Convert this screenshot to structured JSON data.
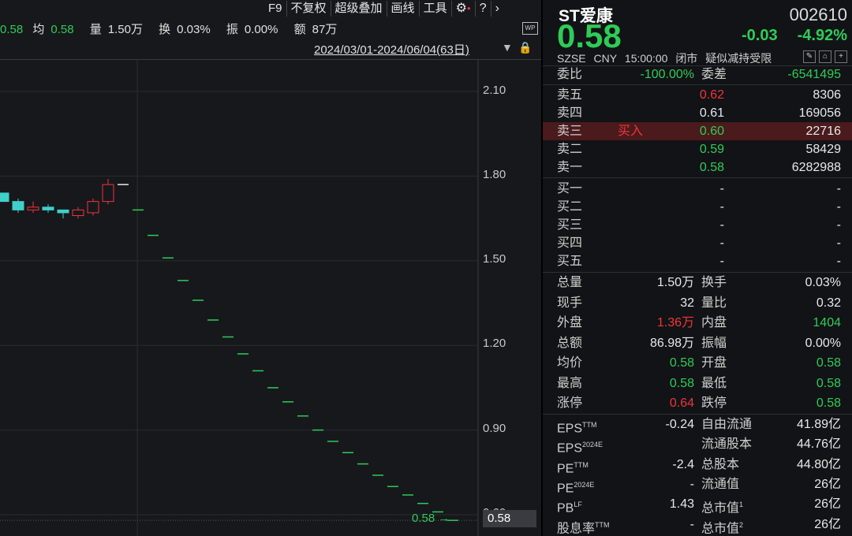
{
  "toolbar": {
    "items": [
      "F9",
      "不复权",
      "超级叠加",
      "画线",
      "工具"
    ],
    "settings_icon": "gear-icon",
    "help_icon": "help-icon",
    "next_icon": "chevron-right-icon"
  },
  "stats": {
    "last": "0.58",
    "avg_label": "均",
    "avg": "0.58",
    "vol_label": "量",
    "vol": "1.50万",
    "turnover_label": "换",
    "turnover": "0.03%",
    "amp_label": "振",
    "amp": "0.00%",
    "amount_label": "额",
    "amount": "87万"
  },
  "range": "2024/03/01-2024/06/04(63日)",
  "y_ticks": [
    "2.10",
    "1.80",
    "1.50",
    "1.20",
    "0.90",
    "0.60"
  ],
  "last_price_label": "0.58",
  "last_price_box": "0.58",
  "colors": {
    "up": "#f0353a",
    "down": "#2ecc57",
    "flat": "#e8e8e8",
    "candle_down": "#3fd1c9"
  },
  "chart_data": {
    "type": "candlestick",
    "ylim": [
      0.55,
      2.2
    ],
    "y_ticks": [
      2.1,
      1.8,
      1.5,
      1.2,
      0.9,
      0.6
    ],
    "candles": [
      {
        "o": 1.74,
        "c": 1.71,
        "h": 1.74,
        "l": 1.71
      },
      {
        "o": 1.71,
        "c": 1.68,
        "h": 1.72,
        "l": 1.67
      },
      {
        "o": 1.68,
        "c": 1.69,
        "h": 1.71,
        "l": 1.67
      },
      {
        "o": 1.69,
        "c": 1.68,
        "h": 1.7,
        "l": 1.67
      },
      {
        "o": 1.68,
        "c": 1.67,
        "h": 1.68,
        "l": 1.65
      },
      {
        "o": 1.66,
        "c": 1.68,
        "h": 1.69,
        "l": 1.65
      },
      {
        "o": 1.67,
        "c": 1.71,
        "h": 1.72,
        "l": 1.66
      },
      {
        "o": 1.71,
        "c": 1.77,
        "h": 1.79,
        "l": 1.7
      },
      {
        "o": 1.77,
        "c": 1.77,
        "h": 1.77,
        "l": 1.77
      },
      {
        "o": 1.68,
        "c": 1.68,
        "h": 1.68,
        "l": 1.68
      },
      {
        "o": 1.59,
        "c": 1.59,
        "h": 1.59,
        "l": 1.59
      },
      {
        "o": 1.51,
        "c": 1.51,
        "h": 1.51,
        "l": 1.51
      },
      {
        "o": 1.43,
        "c": 1.43,
        "h": 1.43,
        "l": 1.43
      },
      {
        "o": 1.36,
        "c": 1.36,
        "h": 1.36,
        "l": 1.36
      },
      {
        "o": 1.29,
        "c": 1.29,
        "h": 1.29,
        "l": 1.29
      },
      {
        "o": 1.23,
        "c": 1.23,
        "h": 1.23,
        "l": 1.23
      },
      {
        "o": 1.17,
        "c": 1.17,
        "h": 1.17,
        "l": 1.17
      },
      {
        "o": 1.11,
        "c": 1.11,
        "h": 1.11,
        "l": 1.11
      },
      {
        "o": 1.05,
        "c": 1.05,
        "h": 1.05,
        "l": 1.05
      },
      {
        "o": 1.0,
        "c": 1.0,
        "h": 1.0,
        "l": 1.0
      },
      {
        "o": 0.95,
        "c": 0.95,
        "h": 0.95,
        "l": 0.95
      },
      {
        "o": 0.9,
        "c": 0.9,
        "h": 0.9,
        "l": 0.9
      },
      {
        "o": 0.86,
        "c": 0.86,
        "h": 0.86,
        "l": 0.86
      },
      {
        "o": 0.82,
        "c": 0.82,
        "h": 0.82,
        "l": 0.82
      },
      {
        "o": 0.78,
        "c": 0.78,
        "h": 0.78,
        "l": 0.78
      },
      {
        "o": 0.74,
        "c": 0.74,
        "h": 0.74,
        "l": 0.74
      },
      {
        "o": 0.7,
        "c": 0.7,
        "h": 0.7,
        "l": 0.7
      },
      {
        "o": 0.67,
        "c": 0.67,
        "h": 0.67,
        "l": 0.67
      },
      {
        "o": 0.64,
        "c": 0.64,
        "h": 0.64,
        "l": 0.64
      },
      {
        "o": 0.61,
        "c": 0.61,
        "h": 0.61,
        "l": 0.61
      },
      {
        "o": 0.58,
        "c": 0.58,
        "h": 0.58,
        "l": 0.58
      }
    ]
  },
  "quote": {
    "name": "ST爱康",
    "code": "002610",
    "price": "0.58",
    "change": "-0.03",
    "change_pct": "-4.92%",
    "exchange": "SZSE",
    "currency": "CNY",
    "time": "15:00:00",
    "status": "闭市",
    "note": "疑似减持受限",
    "icons": [
      "edit-icon",
      "alert-icon",
      "add-icon"
    ],
    "ratio": {
      "label1": "委比",
      "val1": "-100.00%",
      "label2": "委差",
      "val2": "-6541495"
    },
    "asks": [
      {
        "label": "卖五",
        "tag": "",
        "price": "0.62",
        "vol": "8306",
        "color": "red"
      },
      {
        "label": "卖四",
        "tag": "",
        "price": "0.61",
        "vol": "169056",
        "color": "white"
      },
      {
        "label": "卖三",
        "tag": "买入",
        "price": "0.60",
        "vol": "22716",
        "color": "green"
      },
      {
        "label": "卖二",
        "tag": "",
        "price": "0.59",
        "vol": "58429",
        "color": "green"
      },
      {
        "label": "卖一",
        "tag": "",
        "price": "0.58",
        "vol": "6282988",
        "color": "green"
      }
    ],
    "bids": [
      {
        "label": "买一",
        "price": "-",
        "vol": "-"
      },
      {
        "label": "买二",
        "price": "-",
        "vol": "-"
      },
      {
        "label": "买三",
        "price": "-",
        "vol": "-"
      },
      {
        "label": "买四",
        "price": "-",
        "vol": "-"
      },
      {
        "label": "买五",
        "price": "-",
        "vol": "-"
      }
    ],
    "stats": [
      {
        "l1": "总量",
        "v1": "1.50万",
        "c1": "white",
        "l2": "换手",
        "v2": "0.03%",
        "c2": "white"
      },
      {
        "l1": "现手",
        "v1": "32",
        "c1": "white",
        "l2": "量比",
        "v2": "0.32",
        "c2": "white"
      },
      {
        "l1": "外盘",
        "v1": "1.36万",
        "c1": "red",
        "l2": "内盘",
        "v2": "1404",
        "c2": "green"
      },
      {
        "l1": "总额",
        "v1": "86.98万",
        "c1": "white",
        "l2": "振幅",
        "v2": "0.00%",
        "c2": "white"
      },
      {
        "l1": "均价",
        "v1": "0.58",
        "c1": "green",
        "l2": "开盘",
        "v2": "0.58",
        "c2": "green"
      },
      {
        "l1": "最高",
        "v1": "0.58",
        "c1": "green",
        "l2": "最低",
        "v2": "0.58",
        "c2": "green"
      },
      {
        "l1": "涨停",
        "v1": "0.64",
        "c1": "red",
        "l2": "跌停",
        "v2": "0.58",
        "c2": "green"
      }
    ],
    "fundamentals": [
      {
        "l1": "EPS",
        "s1": "TTM",
        "v1": "-0.24",
        "l2": "自由流通",
        "s2": "",
        "v2": "41.89亿"
      },
      {
        "l1": "EPS",
        "s1": "2024E",
        "v1": "",
        "l2": "流通股本",
        "s2": "",
        "v2": "44.76亿"
      },
      {
        "l1": "PE",
        "s1": "TTM",
        "v1": "-2.4",
        "l2": "总股本",
        "s2": "",
        "v2": "44.80亿"
      },
      {
        "l1": "PE",
        "s1": "2024E",
        "v1": "-",
        "l2": "流通值",
        "s2": "",
        "v2": "26亿"
      },
      {
        "l1": "PB",
        "s1": "LF",
        "v1": "1.43",
        "l2": "总市值",
        "s2": "1",
        "v2": "26亿"
      },
      {
        "l1": "股息率",
        "s1": "TTM",
        "v1": "-",
        "l2": "总市值",
        "s2": "2",
        "v2": "26亿"
      }
    ]
  }
}
